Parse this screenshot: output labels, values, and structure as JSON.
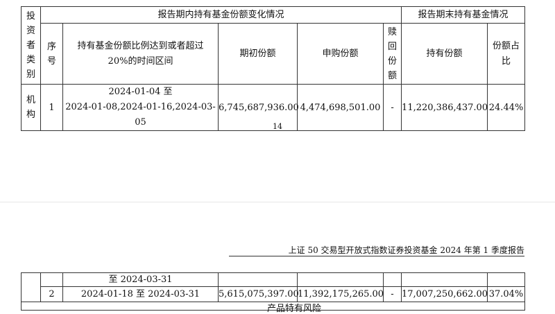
{
  "table1": {
    "col_investor_type": [
      "投",
      "资",
      "者",
      "类",
      "别"
    ],
    "group_change": "报告期内持有基金份额变化情况",
    "group_end": "报告期末持有基金情况",
    "col_seq": [
      "序",
      "号"
    ],
    "col_period": [
      "持有基金份额比例达到或者超过",
      "20%的时间区间"
    ],
    "col_begin": "期初份额",
    "col_subscribe": "申购份额",
    "col_redeem": [
      "赎",
      "回",
      "份",
      "额"
    ],
    "col_holding": "持有份额",
    "col_ratio": [
      "份额占",
      "比"
    ],
    "row": {
      "type": [
        "机",
        "构"
      ],
      "seq": "1",
      "period": [
        "2024-01-04 至",
        "2024-01-08,2024-01-16,2024-03-05"
      ],
      "begin": "6,745,687,936.00",
      "subscribe": "4,474,698,501.00",
      "redeem": "-",
      "holding": "11,220,386,437.00",
      "ratio": "24.44%"
    }
  },
  "page_number": "14",
  "page2_header": "上证 50 交易型开放式指数证券投资基金 2024 年第 1 季度报告",
  "table2": {
    "cont_period": "至 2024-03-31",
    "row": {
      "seq": "2",
      "period": "2024-01-18 至 2024-03-31",
      "begin": "5,615,075,397.00",
      "subscribe": "11,392,175,265.00",
      "redeem": "-",
      "holding": "17,007,250,662.00",
      "ratio": "37.04%"
    },
    "next_section": "产品特有风险"
  }
}
